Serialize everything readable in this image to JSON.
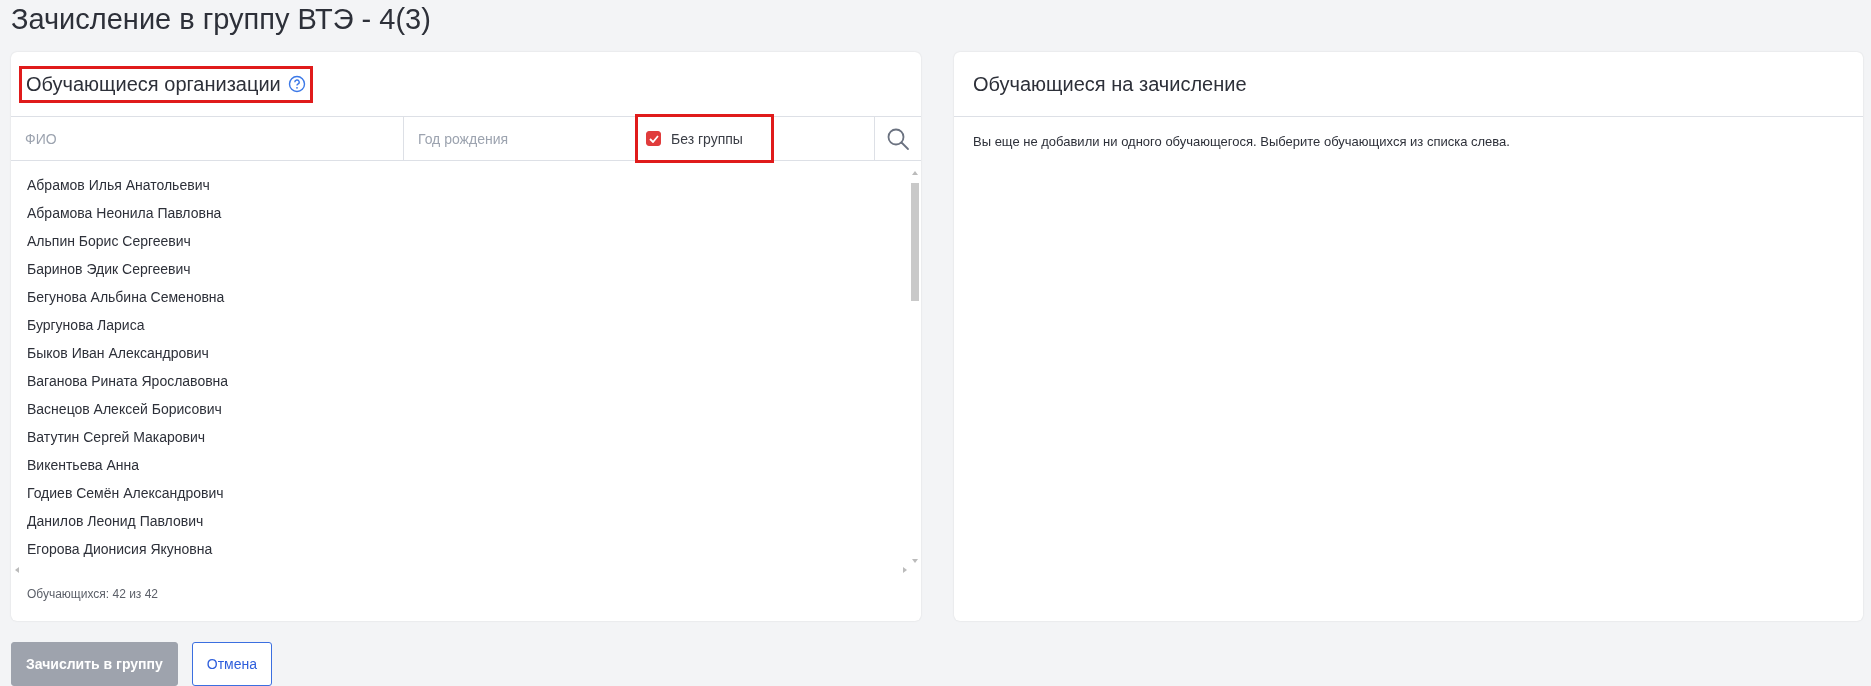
{
  "page_title": "Зачисление в группу ВТЭ - 4(3)",
  "left_panel": {
    "title": "Обучающиеся организации",
    "highlighted": true,
    "filters": {
      "name_field": {
        "placeholder": "ФИО"
      },
      "birth_year_field": {
        "placeholder": "Год рождения"
      },
      "no_group": {
        "label": "Без группы",
        "checked": true,
        "highlighted": true
      }
    },
    "students": [
      "Абрамов Илья Анатольевич",
      "Абрамова Неонила Павловна",
      "Альпин Борис Сергеевич",
      "Баринов Эдик Сергеевич",
      "Бегунова Альбина Семеновна",
      "Бургунова Лариса",
      "Быков Иван Александрович",
      "Ваганова Рината Ярославовна",
      "Васнецов Алексей Борисович",
      "Ватутин Сергей Макарович",
      "Викентьева Анна",
      "Годиев Семён Александрович",
      "Данилов Леонид Павлович",
      "Егорова Дионисия Якуновна"
    ],
    "count": "Обучающихся: 42 из 42"
  },
  "right_panel": {
    "title": "Обучающиеся на зачисление",
    "empty_message": "Вы еще не добавили ни одного обучающегося. Выберите обучающихся из списка слева."
  },
  "buttons": [
    {
      "label": "Зачислить в группу",
      "kind": "primary",
      "disabled": true
    },
    {
      "label": "Отмена",
      "kind": "outline",
      "disabled": false
    }
  ]
}
